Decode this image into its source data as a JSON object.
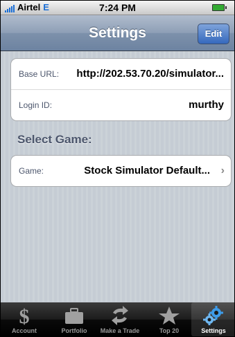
{
  "status_bar": {
    "carrier": "Airtel",
    "network": "E",
    "time": "7:24 PM"
  },
  "nav": {
    "title": "Settings",
    "edit_label": "Edit"
  },
  "settings": {
    "base_url_label": "Base URL:",
    "base_url_value": "http://202.53.70.20/simulator...",
    "login_label": "Login ID:",
    "login_value": "murthy",
    "section_title": "Select Game:",
    "game_label": "Game:",
    "game_value": "Stock Simulator Default..."
  },
  "tabs": [
    {
      "label": "Account",
      "icon": "dollar-icon"
    },
    {
      "label": "Portfolio",
      "icon": "briefcase-icon"
    },
    {
      "label": "Make a Trade",
      "icon": "trade-arrows-icon"
    },
    {
      "label": "Top 20",
      "icon": "star-icon"
    },
    {
      "label": "Settings",
      "icon": "settings-gears-icon"
    }
  ],
  "colors": {
    "nav": "#7d91ab",
    "accent": "#3569bd",
    "background": "#c5ccd4"
  }
}
